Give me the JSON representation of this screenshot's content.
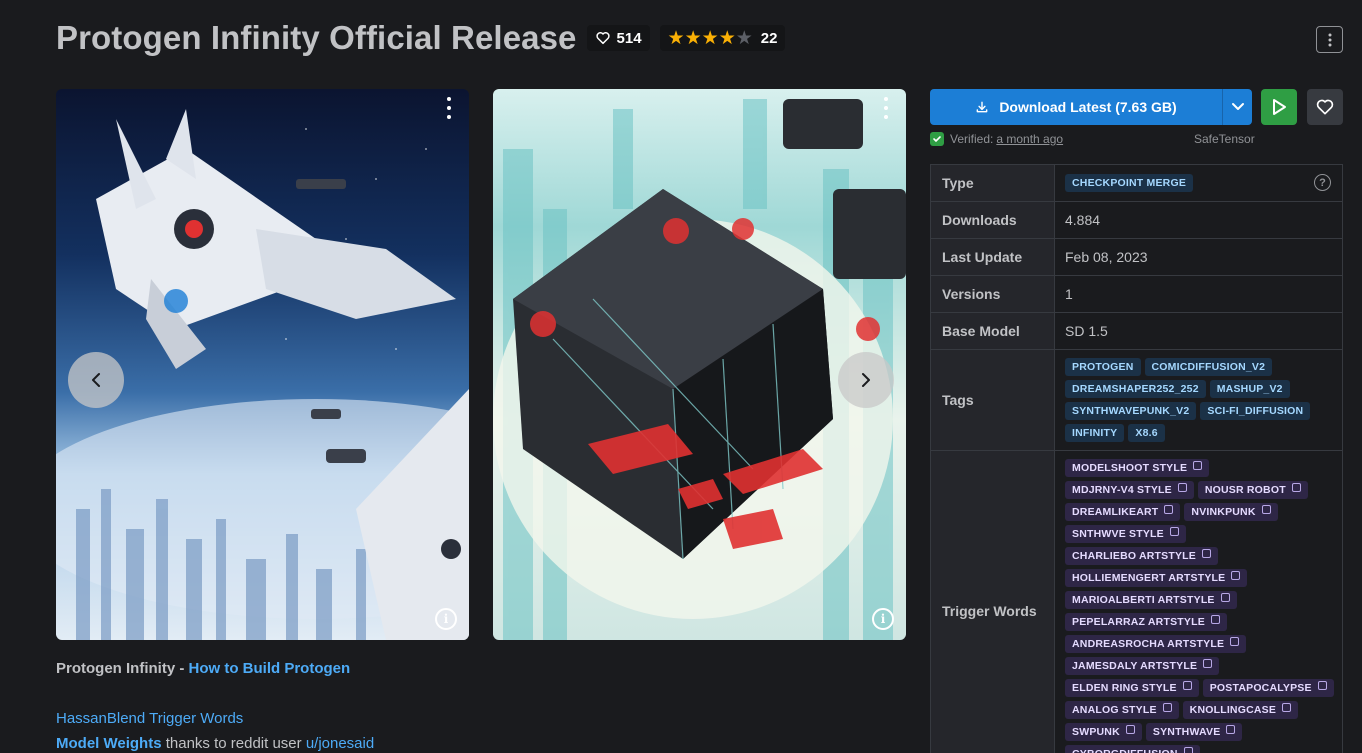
{
  "header": {
    "title": "Protogen Infinity Official Release",
    "likes": "514",
    "rating_count": "22",
    "rating_value": 4.5
  },
  "gallery": {
    "images": [
      {
        "alt": "spaceship over futuristic city"
      },
      {
        "alt": "floating black cube"
      }
    ]
  },
  "description": {
    "line1_bold": "Protogen Infinity - ",
    "line1_link": "How to Build Protogen",
    "line2_link": "HassanBlend Trigger Words",
    "line3_link": "Model Weights",
    "line3_text": " thanks to reddit user ",
    "line3_user": "u/jonesaid"
  },
  "download": {
    "label": "Download Latest (7.63 GB)",
    "verified_label": "Verified:",
    "verified_time": "a month ago",
    "format": "SafeTensor"
  },
  "details": {
    "type_label": "Type",
    "type_value": "CHECKPOINT MERGE",
    "downloads_label": "Downloads",
    "downloads_value": "4.884",
    "last_update_label": "Last Update",
    "last_update_value": "Feb 08, 2023",
    "versions_label": "Versions",
    "versions_value": "1",
    "base_model_label": "Base Model",
    "base_model_value": "SD 1.5",
    "tags_label": "Tags",
    "tags": [
      "PROTOGEN",
      "COMICDIFFUSION_V2",
      "DREAMSHAPER252_252",
      "MASHUP_V2",
      "SYNTHWAVEPUNK_V2",
      "SCI-FI_DIFFUSION",
      "INFINITY",
      "X8.6"
    ],
    "trigger_label": "Trigger Words",
    "trigger_words": [
      "MODELSHOOT STYLE",
      "MDJRNY-V4 STYLE",
      "NOUSR ROBOT",
      "DREAMLIKEART",
      "NVINKPUNK",
      "SNTHWVE STYLE",
      "CHARLIEBO ARTSTYLE",
      "HOLLIEMENGERT ARTSTYLE",
      "MARIOALBERTI ARTSTYLE",
      "PEPELARRAZ ARTSTYLE",
      "ANDREASROCHA ARTSTYLE",
      "JAMESDALY ARTSTYLE",
      "ELDEN RING STYLE",
      "POSTAPOCALYPSE",
      "ANALOG STYLE",
      "KNOLLINGCASE",
      "SWPUNK",
      "SYNTHWAVE",
      "CYBORGDIFFUSION"
    ]
  },
  "colors": {
    "background": "#1a1b1e",
    "primary": "#1c7ed6",
    "success": "#2f9e44",
    "star": "#fab005"
  }
}
